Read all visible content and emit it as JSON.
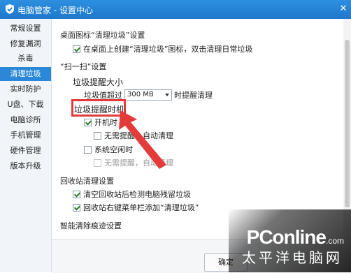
{
  "window": {
    "title": "电脑管家 - 设置中心"
  },
  "sidebar": {
    "items": [
      {
        "label": "常规设置"
      },
      {
        "label": "修复漏洞"
      },
      {
        "label": "杀毒"
      },
      {
        "label": "清理垃圾",
        "active": true
      },
      {
        "label": "实时防护"
      },
      {
        "label": "U盘、下载"
      },
      {
        "label": "电脑诊所"
      },
      {
        "label": "手机管理"
      },
      {
        "label": "硬件管理"
      },
      {
        "label": "版本升级"
      }
    ]
  },
  "desktop_icon": {
    "title": "桌面图标“清理垃圾”设置",
    "option": "在桌面上创建“清理垃圾”图标，双击清理日常垃圾"
  },
  "scan": {
    "title": "“扫一扫”设置",
    "size_title": "垃圾提醒大小",
    "threshold_prefix": "垃圾值超过",
    "threshold_value": "300 MB",
    "threshold_suffix": "时提醒清理",
    "time_title": "垃圾提醒时机",
    "on_boot": "开机时",
    "on_boot_auto": "无需提醒，自动清理",
    "on_idle": "系统空闲时",
    "on_idle_auto": "无需提醒，自动清理"
  },
  "recycle": {
    "title": "回收站清理设置",
    "option1": "清空回收站后检测电脑残留垃圾",
    "option2": "回收站右键菜单栏添加“清理垃圾”"
  },
  "smart": {
    "title": "智能清除痕迹设置"
  },
  "footer": {
    "ok_label": "确定"
  },
  "watermark": {
    "brand": "PConline",
    "brand_suffix": ".com",
    "sub": "太平洋电脑网"
  },
  "colors": {
    "titlebar": "#1f78cc",
    "active_item": "#2b88d8",
    "highlight": "#e43a3a"
  }
}
